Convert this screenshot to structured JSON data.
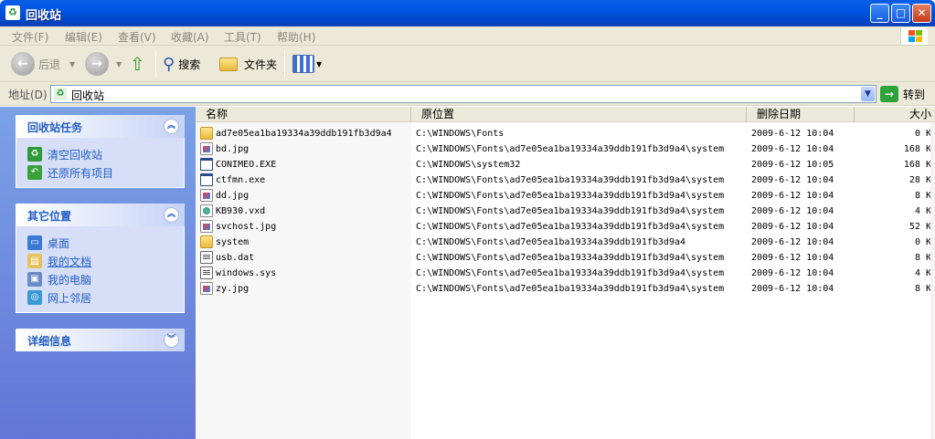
{
  "window": {
    "title": "回收站"
  },
  "menu": [
    "文件(F)",
    "编辑(E)",
    "查看(V)",
    "收藏(A)",
    "工具(T)",
    "帮助(H)"
  ],
  "toolbar": {
    "back": "后退",
    "search": "搜索",
    "folders": "文件夹"
  },
  "address": {
    "label": "地址(D)",
    "value": "回收站",
    "go": "转到"
  },
  "panels": {
    "tasks": {
      "title": "回收站任务",
      "items": [
        "清空回收站",
        "还原所有项目"
      ]
    },
    "places": {
      "title": "其它位置",
      "items": [
        "桌面",
        "我的文档",
        "我的电脑",
        "网上邻居"
      ]
    },
    "details": {
      "title": "详细信息"
    }
  },
  "columns": {
    "name": "名称",
    "origin": "原位置",
    "date": "删除日期",
    "size": "大小"
  },
  "files": [
    {
      "name": "ad7e05ea1ba19334a39ddb191fb3d9a4",
      "icon": "folder",
      "origin": "C:\\WINDOWS\\Fonts",
      "date": "2009-6-12 10:04",
      "size": "0 K"
    },
    {
      "name": "bd.jpg",
      "icon": "image",
      "origin": "C:\\WINDOWS\\Fonts\\ad7e05ea1ba19334a39ddb191fb3d9a4\\system",
      "date": "2009-6-12 10:04",
      "size": "168 K"
    },
    {
      "name": "CONIMEO.EXE",
      "icon": "exe",
      "origin": "C:\\WINDOWS\\system32",
      "date": "2009-6-12 10:05",
      "size": "168 K"
    },
    {
      "name": "ctfmn.exe",
      "icon": "exe",
      "origin": "C:\\WINDOWS\\Fonts\\ad7e05ea1ba19334a39ddb191fb3d9a4\\system",
      "date": "2009-6-12 10:04",
      "size": "28 K"
    },
    {
      "name": "dd.jpg",
      "icon": "image",
      "origin": "C:\\WINDOWS\\Fonts\\ad7e05ea1ba19334a39ddb191fb3d9a4\\system",
      "date": "2009-6-12 10:04",
      "size": "8 K"
    },
    {
      "name": "KB930.vxd",
      "icon": "vxd",
      "origin": "C:\\WINDOWS\\Fonts\\ad7e05ea1ba19334a39ddb191fb3d9a4\\system",
      "date": "2009-6-12 10:04",
      "size": "4 K"
    },
    {
      "name": "svchost.jpg",
      "icon": "image",
      "origin": "C:\\WINDOWS\\Fonts\\ad7e05ea1ba19334a39ddb191fb3d9a4\\system",
      "date": "2009-6-12 10:04",
      "size": "52 K"
    },
    {
      "name": "system",
      "icon": "folder",
      "origin": "C:\\WINDOWS\\Fonts\\ad7e05ea1ba19334a39ddb191fb3d9a4",
      "date": "2009-6-12 10:04",
      "size": "0 K"
    },
    {
      "name": "usb.dat",
      "icon": "sysfile",
      "origin": "C:\\WINDOWS\\Fonts\\ad7e05ea1ba19334a39ddb191fb3d9a4\\system",
      "date": "2009-6-12 10:04",
      "size": "8 K"
    },
    {
      "name": "windows.sys",
      "icon": "sysfile",
      "origin": "C:\\WINDOWS\\Fonts\\ad7e05ea1ba19334a39ddb191fb3d9a4\\system",
      "date": "2009-6-12 10:04",
      "size": "4 K"
    },
    {
      "name": "zy.jpg",
      "icon": "image",
      "origin": "C:\\WINDOWS\\Fonts\\ad7e05ea1ba19334a39ddb191fb3d9a4\\system",
      "date": "2009-6-12 10:04",
      "size": "8 K"
    }
  ]
}
